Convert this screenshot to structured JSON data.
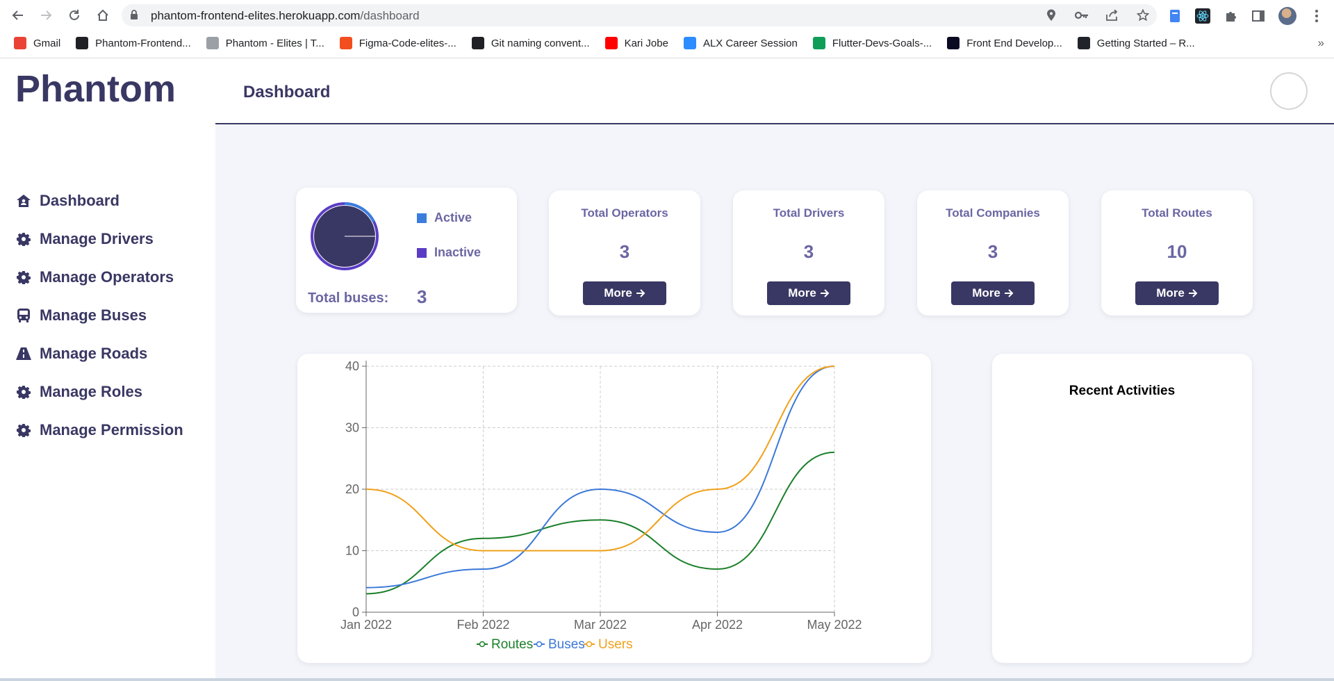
{
  "browser": {
    "url_host": "phantom-frontend-elites.herokuapp.com",
    "url_path": "/dashboard",
    "bookmarks": [
      {
        "label": "Gmail",
        "icon": "gmail-icon",
        "color": "#ea4335"
      },
      {
        "label": "Phantom-Frontend...",
        "icon": "github-icon",
        "color": "#202124"
      },
      {
        "label": "Phantom - Elites | T...",
        "icon": "page-icon",
        "color": "#9aa0a6"
      },
      {
        "label": "Figma-Code-elites-...",
        "icon": "figma-icon",
        "color": "#f24e1e"
      },
      {
        "label": "Git naming convent...",
        "icon": "github-icon",
        "color": "#202124"
      },
      {
        "label": "Kari Jobe",
        "icon": "youtube-icon",
        "color": "#ff0000"
      },
      {
        "label": "ALX Career Session",
        "icon": "zoom-icon",
        "color": "#2d8cff"
      },
      {
        "label": "Flutter-Devs-Goals-...",
        "icon": "sheets-icon",
        "color": "#0f9d58"
      },
      {
        "label": "Front End Develop...",
        "icon": "fcc-icon",
        "color": "#0a0a23"
      },
      {
        "label": "Getting Started – R...",
        "icon": "react-icon",
        "color": "#20232a"
      }
    ],
    "more_bookmarks": "»"
  },
  "sidebar": {
    "brand": "Phantom",
    "items": [
      {
        "label": "Dashboard",
        "icon": "home-icon"
      },
      {
        "label": "Manage Drivers",
        "icon": "gear-icon"
      },
      {
        "label": "Manage Operators",
        "icon": "gear-icon"
      },
      {
        "label": "Manage Buses",
        "icon": "bus-icon"
      },
      {
        "label": "Manage Roads",
        "icon": "road-icon"
      },
      {
        "label": "Manage Roles",
        "icon": "gear-icon"
      },
      {
        "label": "Manage Permission",
        "icon": "gear-icon"
      }
    ]
  },
  "header": {
    "title": "Dashboard"
  },
  "buses": {
    "legend_active": "Active",
    "legend_inactive": "Inactive",
    "total_label": "Total buses:",
    "total_value": "3",
    "active_color": "#3b7ddd",
    "inactive_color": "#5b3cc4",
    "donut_color": "#393763"
  },
  "stats": {
    "operators": {
      "label": "Total Operators",
      "value": "3",
      "button": "More"
    },
    "drivers": {
      "label": "Total Drivers",
      "value": "3",
      "button": "More"
    },
    "companies": {
      "label": "Total Companies",
      "value": "3",
      "button": "More"
    },
    "routes": {
      "label": "Total Routes",
      "value": "10",
      "button": "More"
    }
  },
  "activities": {
    "heading": "Recent Activities"
  },
  "colors": {
    "brand": "#393763",
    "muted_text": "#6a66a3",
    "background": "#f3f5fa"
  },
  "chart_data": {
    "type": "line",
    "categories": [
      "Jan 2022",
      "Feb 2022",
      "Mar 2022",
      "Apr 2022",
      "May 2022"
    ],
    "ylim": [
      0,
      40
    ],
    "yticks": [
      0,
      10,
      20,
      30,
      40
    ],
    "grid": true,
    "legend_position": "bottom",
    "series": [
      {
        "name": "Routes",
        "color": "#1b7f2a",
        "values": [
          3,
          12,
          15,
          7,
          26
        ]
      },
      {
        "name": "Buses",
        "color": "#3b78d8",
        "values": [
          4,
          7,
          20,
          13,
          40
        ]
      },
      {
        "name": "Users",
        "color": "#f0a01a",
        "values": [
          20,
          10,
          10,
          20,
          40
        ]
      }
    ]
  }
}
